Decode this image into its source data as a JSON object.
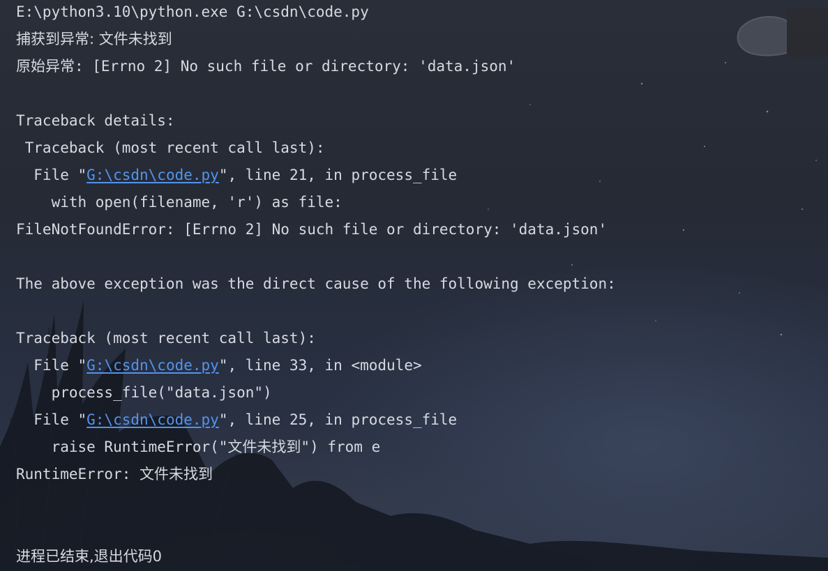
{
  "console": {
    "command": "E:\\python3.10\\python.exe G:\\csdn\\code.py",
    "caught": "捕获到异常: 文件未找到",
    "original": "原始异常: [Errno 2] No such file or directory: 'data.json'",
    "tb_details": "Traceback details:",
    "tb1_header": " Traceback (most recent call last):",
    "tb1_frame": {
      "prefix": "  File \"",
      "link": "G:\\csdn\\code.py",
      "suffix": "\", line 21, in process_file"
    },
    "tb1_code": "    with open(filename, 'r') as file:",
    "tb1_error": "FileNotFoundError: [Errno 2] No such file or directory: 'data.json'",
    "cause_msg": "The above exception was the direct cause of the following exception:",
    "tb2_header": "Traceback (most recent call last):",
    "tb2_frame1": {
      "prefix": "  File \"",
      "link": "G:\\csdn\\code.py",
      "suffix": "\", line 33, in <module>"
    },
    "tb2_code1": "    process_file(\"data.json\")",
    "tb2_frame2": {
      "prefix": "  File \"",
      "link": "G:\\csdn\\code.py",
      "suffix": "\", line 25, in process_file"
    },
    "tb2_code2": "    raise RuntimeError(\"文件未找到\") from e",
    "final_error": "RuntimeError: 文件未找到",
    "exit": "进程已结束,退出代码0"
  },
  "colors": {
    "text": "#d7dae0",
    "link": "#5394ec",
    "background": "#262a33"
  }
}
